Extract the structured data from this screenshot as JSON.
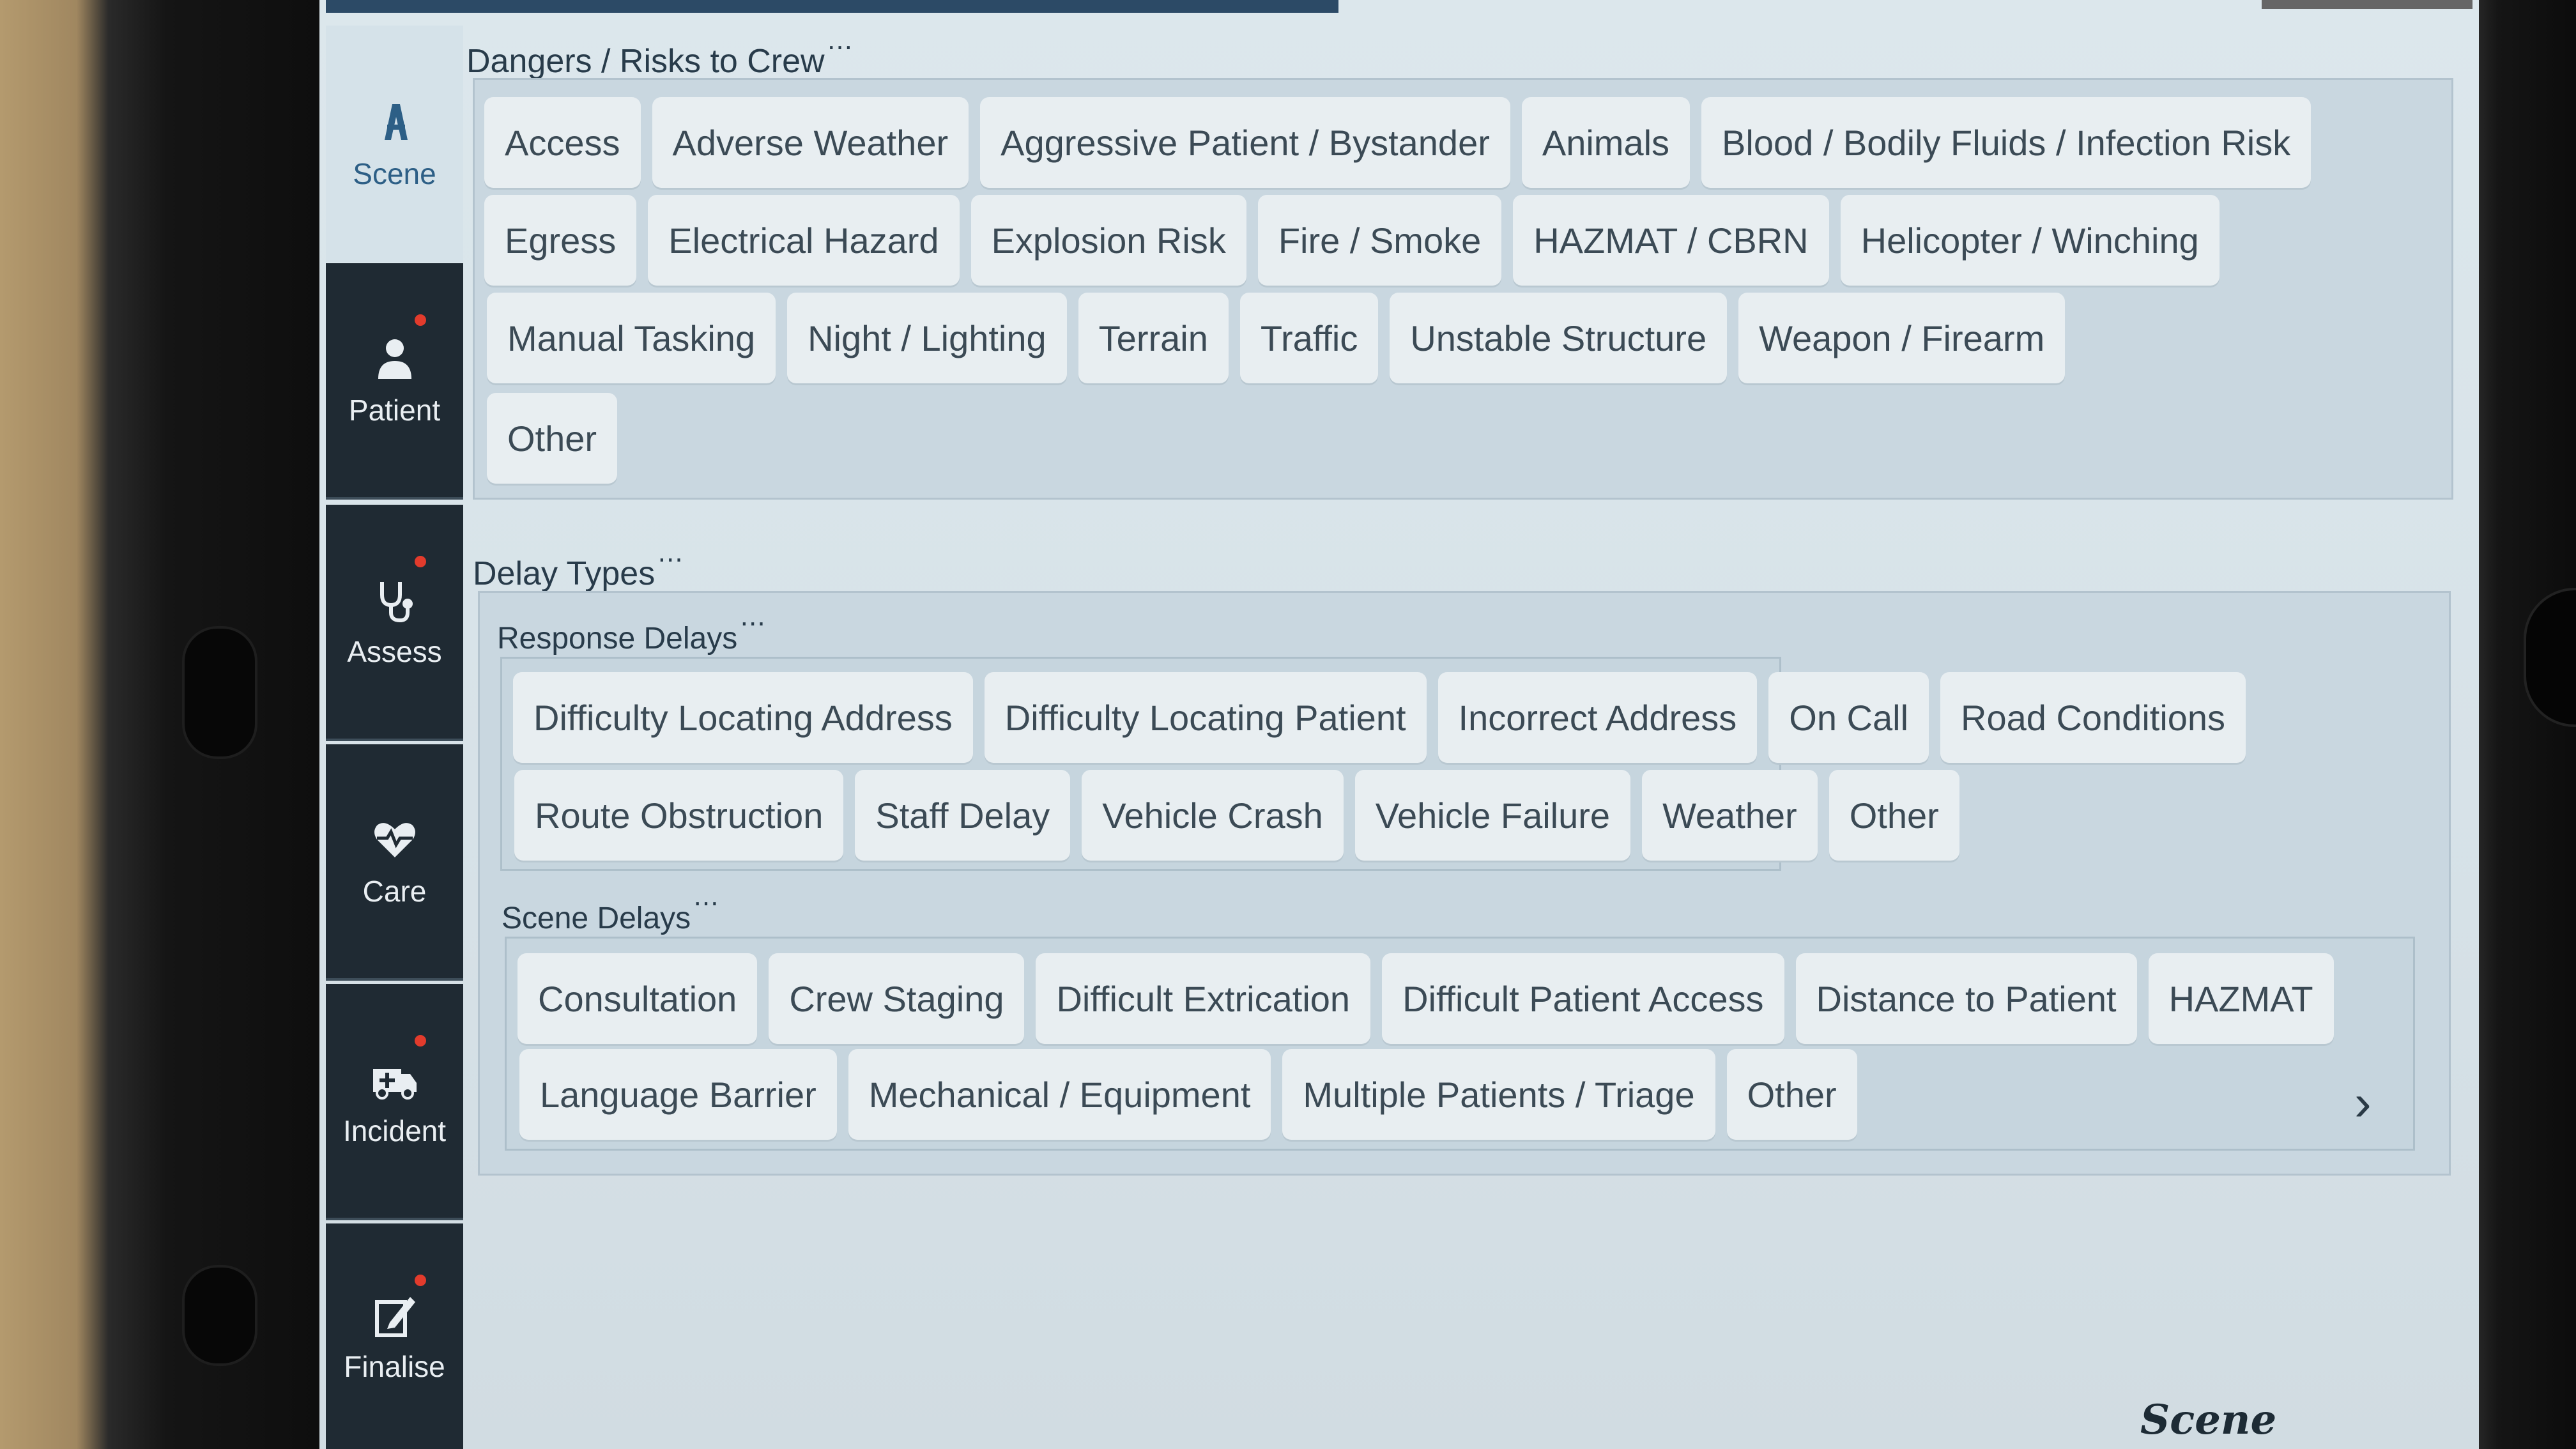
{
  "nav": {
    "items": [
      {
        "label": "Scene",
        "icon": "scene-icon",
        "active": true
      },
      {
        "label": "Patient",
        "icon": "patient-icon"
      },
      {
        "label": "Assess",
        "icon": "stethoscope-icon"
      },
      {
        "label": "Care",
        "icon": "heart-icon"
      },
      {
        "label": "Incident",
        "icon": "ambulance-icon"
      },
      {
        "label": "Finalise",
        "icon": "edit-icon"
      }
    ]
  },
  "dangers": {
    "title": "Dangers / Risks to Crew",
    "rows": [
      [
        "Access",
        "Adverse Weather",
        "Aggressive Patient / Bystander",
        "Animals",
        "Blood / Bodily Fluids / Infection Risk"
      ],
      [
        "Egress",
        "Electrical Hazard",
        "Explosion Risk",
        "Fire / Smoke",
        "HAZMAT / CBRN",
        "Helicopter / Winching"
      ],
      [
        "Manual Tasking",
        "Night / Lighting",
        "Terrain",
        "Traffic",
        "Unstable Structure",
        "Weapon / Firearm"
      ],
      [
        "Other"
      ]
    ]
  },
  "delays": {
    "title": "Delay Types",
    "response": {
      "title": "Response Delays",
      "rows": [
        [
          "Difficulty Locating Address",
          "Difficulty Locating Patient",
          "Incorrect Address",
          "On Call",
          "Road Conditions"
        ],
        [
          "Route Obstruction",
          "Staff Delay",
          "Vehicle Crash",
          "Vehicle Failure",
          "Weather",
          "Other"
        ]
      ]
    },
    "scene": {
      "title": "Scene Delays",
      "rows": [
        [
          "Consultation",
          "Crew Staging",
          "Difficult Extrication",
          "Difficult Patient Access",
          "Distance to Patient",
          "HAZMAT"
        ],
        [
          "Language Barrier",
          "Mechanical / Equipment",
          "Multiple Patients / Triage",
          "Other"
        ]
      ]
    }
  },
  "footer": {
    "label": "Scene"
  },
  "colors": {
    "accent": "#2d5f86",
    "sidebar_bg": "#1f2a33",
    "chip_bg": "#e8eef1",
    "alert_dot": "#e23b2c"
  }
}
